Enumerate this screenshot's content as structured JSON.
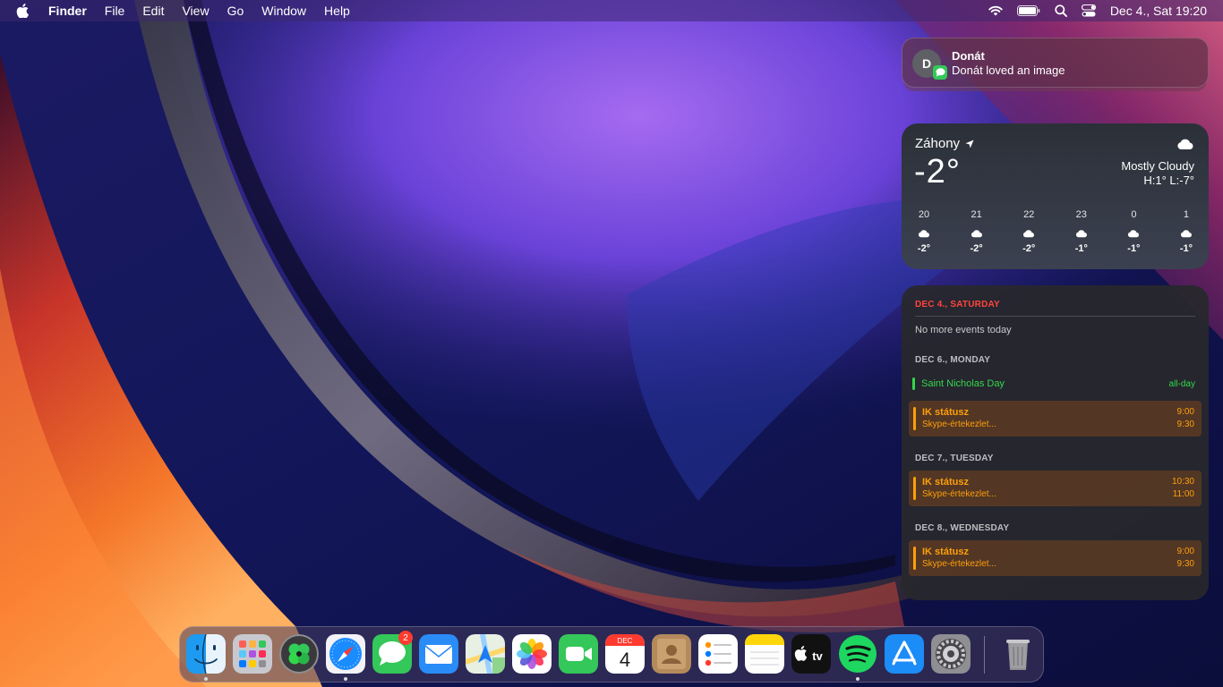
{
  "menubar": {
    "app_name": "Finder",
    "items": [
      "File",
      "Edit",
      "View",
      "Go",
      "Window",
      "Help"
    ],
    "clock": "Dec 4., Sat  19:20"
  },
  "notification": {
    "avatar_initial": "D",
    "title": "Donát",
    "body": "Donát loved an image",
    "badge_icon": "messages-icon"
  },
  "weather": {
    "location": "Záhony",
    "temperature": "-2°",
    "condition": "Mostly Cloudy",
    "high_low": "H:1° L:-7°",
    "hourly": [
      {
        "hour": "20",
        "temp": "-2°",
        "icon": "cloud-icon"
      },
      {
        "hour": "21",
        "temp": "-2°",
        "icon": "cloud-icon"
      },
      {
        "hour": "22",
        "temp": "-2°",
        "icon": "cloud-icon"
      },
      {
        "hour": "23",
        "temp": "-1°",
        "icon": "cloud-icon"
      },
      {
        "hour": "0",
        "temp": "-1°",
        "icon": "cloud-icon"
      },
      {
        "hour": "1",
        "temp": "-1°",
        "icon": "cloud-icon"
      }
    ]
  },
  "calendar": {
    "today_header": "DEC 4., SATURDAY",
    "no_events": "No more events today",
    "days": [
      {
        "header": "DEC 6., MONDAY",
        "all_day": {
          "name": "Saint Nicholas Day",
          "tag": "all-day"
        },
        "event": {
          "title": "IK státusz",
          "subtitle": "Skype-értekezlet...",
          "start": "9:00",
          "end": "9:30"
        }
      },
      {
        "header": "DEC 7., TUESDAY",
        "event": {
          "title": "IK státusz",
          "subtitle": "Skype-értekezlet...",
          "start": "10:30",
          "end": "11:00"
        }
      },
      {
        "header": "DEC 8., WEDNESDAY",
        "event": {
          "title": "IK státusz",
          "subtitle": "Skype-értekezlet...",
          "start": "9:00",
          "end": "9:30"
        }
      }
    ],
    "colors": {
      "today": "#ff453a",
      "holiday": "#32d74b",
      "event": "#ff9f0a"
    }
  },
  "dock": {
    "items": [
      {
        "name": "Finder",
        "icon": "finder-icon",
        "running": true
      },
      {
        "name": "Launchpad",
        "icon": "launchpad-icon",
        "running": false
      },
      {
        "name": "App with clover",
        "icon": "clover-icon",
        "running": false
      },
      {
        "name": "Safari",
        "icon": "safari-icon",
        "running": true
      },
      {
        "name": "Messages",
        "icon": "messages-icon",
        "running": false,
        "badge": "2"
      },
      {
        "name": "Mail",
        "icon": "mail-icon",
        "running": false
      },
      {
        "name": "Maps",
        "icon": "maps-icon",
        "running": false
      },
      {
        "name": "Photos",
        "icon": "photos-icon",
        "running": false
      },
      {
        "name": "FaceTime",
        "icon": "facetime-icon",
        "running": false
      },
      {
        "name": "Calendar",
        "icon": "calendar-icon",
        "running": false,
        "month": "DEC",
        "day": "4"
      },
      {
        "name": "Contacts",
        "icon": "contacts-icon",
        "running": false
      },
      {
        "name": "Reminders",
        "icon": "reminders-icon",
        "running": false
      },
      {
        "name": "Notes",
        "icon": "notes-icon",
        "running": false
      },
      {
        "name": "TV",
        "icon": "tv-icon",
        "running": false,
        "label": "tv"
      },
      {
        "name": "Spotify",
        "icon": "spotify-icon",
        "running": true
      },
      {
        "name": "App Store",
        "icon": "app-store-icon",
        "running": false
      },
      {
        "name": "System Preferences",
        "icon": "system-preferences-icon",
        "running": false
      },
      {
        "name": "Trash",
        "icon": "trash-icon",
        "running": false
      }
    ]
  }
}
